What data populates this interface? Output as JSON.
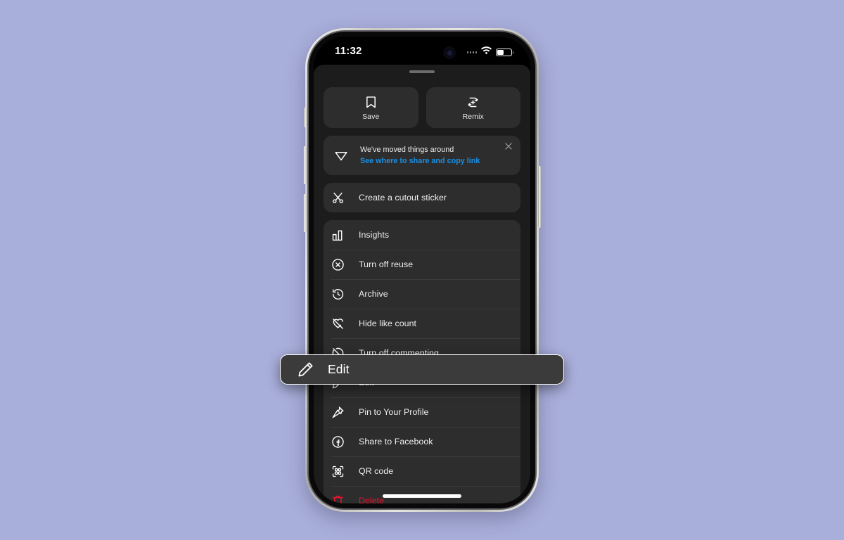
{
  "background_color": "#a9afdb",
  "device": {
    "name": "iphone-frame",
    "status_bar": {
      "time": "11:32",
      "signal_icon": "cellular-dots-icon",
      "wifi_icon": "wifi-icon",
      "battery_icon": "battery-icon"
    },
    "home_indicator": "home-indicator"
  },
  "sheet": {
    "grabber": "drag-handle",
    "tiles": [
      {
        "label": "Save",
        "icon": "bookmark-icon"
      },
      {
        "label": "Remix",
        "icon": "remix-icon"
      }
    ],
    "banner": {
      "icon": "paper-plane-icon",
      "title": "We've moved things around",
      "link": "See where to share and copy link",
      "close_icon": "close-icon",
      "link_color": "#1a90e6"
    },
    "groups": [
      {
        "name": "cutout-group",
        "items": [
          {
            "label": "Create a cutout sticker",
            "icon": "scissors-icon",
            "danger": false
          }
        ]
      },
      {
        "name": "settings-group",
        "items": [
          {
            "label": "Insights",
            "icon": "bar-chart-icon",
            "danger": false
          },
          {
            "label": "Turn off reuse",
            "icon": "circle-x-icon",
            "danger": false
          },
          {
            "label": "Archive",
            "icon": "clock-rewind-icon",
            "danger": false
          },
          {
            "label": "Hide like count",
            "icon": "heart-slash-icon",
            "danger": false
          },
          {
            "label": "Turn off commenting",
            "icon": "comment-slash-icon",
            "danger": false
          },
          {
            "label": "Edit",
            "icon": "pencil-icon",
            "danger": false
          },
          {
            "label": "Pin to Your Profile",
            "icon": "pin-icon",
            "danger": false
          },
          {
            "label": "Share to Facebook",
            "icon": "facebook-icon",
            "danger": false
          },
          {
            "label": "QR code",
            "icon": "qr-code-icon",
            "danger": false
          },
          {
            "label": "Delete",
            "icon": "trash-icon",
            "danger": true
          }
        ]
      }
    ]
  },
  "highlight": {
    "label": "Edit",
    "icon": "pencil-icon",
    "border_color": "#ffffff",
    "background_color": "#3b3b3b"
  }
}
